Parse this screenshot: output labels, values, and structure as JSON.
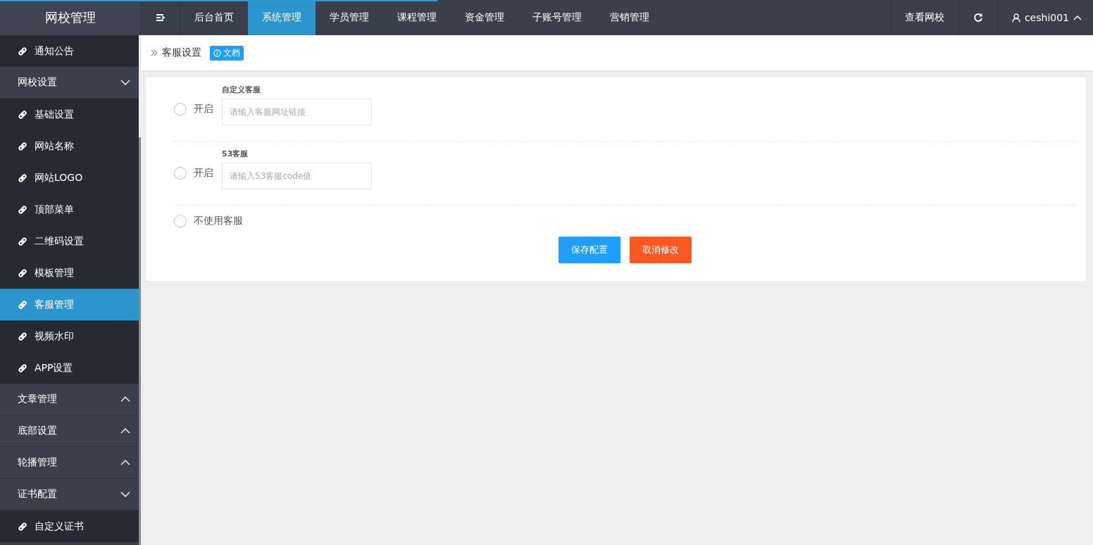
{
  "loading_bar": {
    "level": 0.4
  },
  "brand": {
    "title": "网校管理"
  },
  "top_nav": {
    "items": [
      {
        "label": "后台首页",
        "selected": false
      },
      {
        "label": "系统管理",
        "selected": true
      },
      {
        "label": "学员管理",
        "selected": false
      },
      {
        "label": "课程管理",
        "selected": false
      },
      {
        "label": "资金管理",
        "selected": false
      },
      {
        "label": "子账号管理",
        "selected": false
      },
      {
        "label": "营销管理",
        "selected": false
      }
    ],
    "view_site": "查看网校",
    "user": "ceshi001"
  },
  "sidebar": {
    "items": [
      {
        "kind": "link",
        "label": "通知公告",
        "selected": false
      },
      {
        "kind": "group",
        "label": "网校设置",
        "expanded": true,
        "children": [
          {
            "label": "基础设置",
            "selected": false
          },
          {
            "label": "网站名称",
            "selected": false
          },
          {
            "label": "网站LOGO",
            "selected": false
          },
          {
            "label": "顶部菜单",
            "selected": false
          },
          {
            "label": "二维码设置",
            "selected": false
          },
          {
            "label": "模板管理",
            "selected": false
          },
          {
            "label": "客服管理",
            "selected": true
          },
          {
            "label": "视频水印",
            "selected": false
          },
          {
            "label": "APP设置",
            "selected": false
          }
        ]
      },
      {
        "kind": "group",
        "label": "文章管理",
        "expanded": false
      },
      {
        "kind": "group",
        "label": "底部设置",
        "expanded": false
      },
      {
        "kind": "group",
        "label": "轮播管理",
        "expanded": false
      },
      {
        "kind": "group",
        "label": "证书配置",
        "expanded": true,
        "children": [
          {
            "label": "自定义证书",
            "selected": false
          }
        ]
      }
    ]
  },
  "breadcrumb": {
    "title": "客服设置",
    "doc_badge": "文档"
  },
  "options": [
    {
      "kind": "field",
      "title": "自定义客服",
      "label": "开启",
      "placeholder": "请输入客服网址链接",
      "selected": false
    },
    {
      "kind": "field",
      "title": "53客服",
      "label": "开启",
      "placeholder": "请输入53客服code值",
      "selected": false
    },
    {
      "kind": "plain",
      "label": "不使用客服",
      "selected": false
    }
  ],
  "buttons": [
    {
      "kind": "primary",
      "label": "保存配置"
    },
    {
      "kind": "danger",
      "label": "取消修改"
    }
  ]
}
